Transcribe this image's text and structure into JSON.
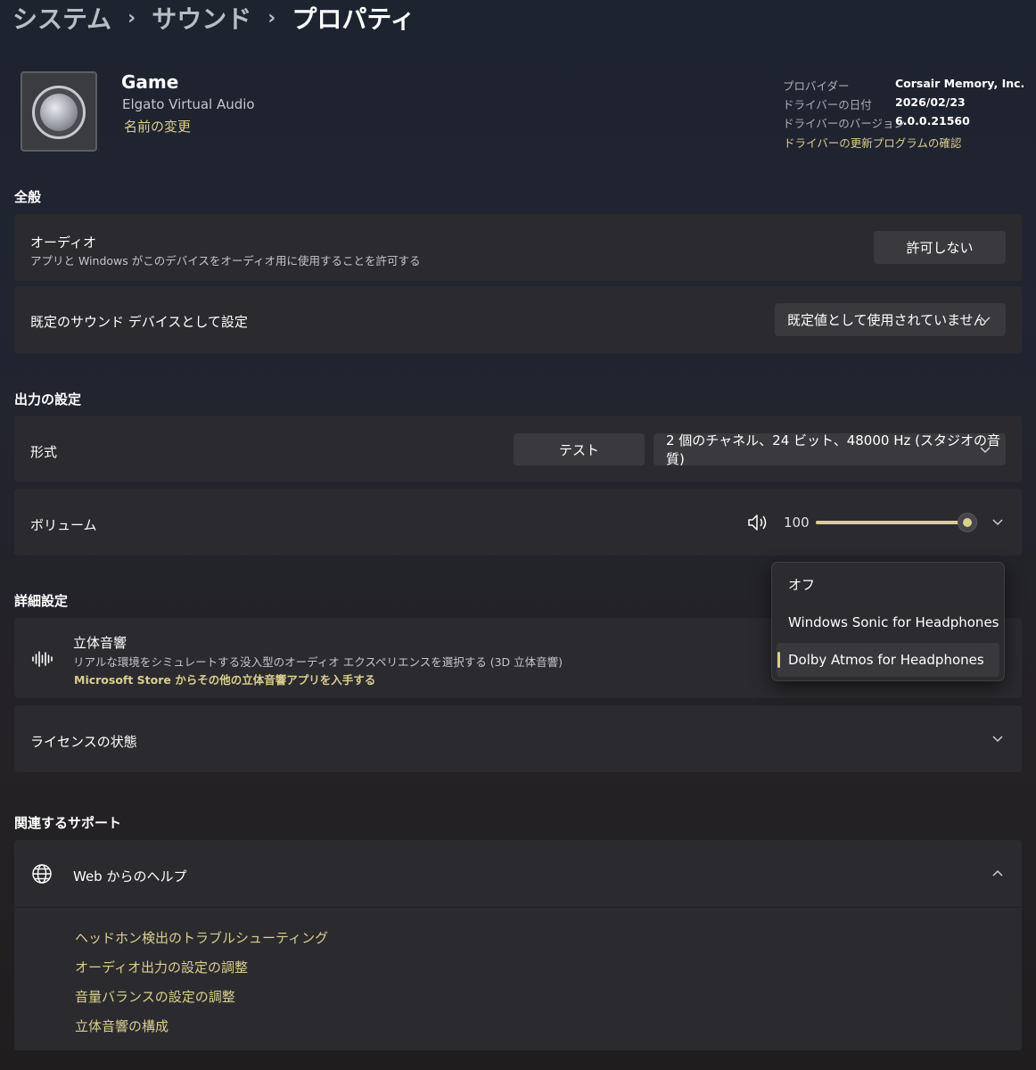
{
  "breadcrumb": [
    "システム",
    "サウンド",
    "プロパティ"
  ],
  "device": {
    "name": "Game",
    "subtitle": "Elgato Virtual Audio",
    "rename_label": "名前の変更",
    "icon": "speaker-icon"
  },
  "driver_info": {
    "provider_label": "プロバイダー",
    "provider_value": "Corsair Memory, Inc.",
    "date_label": "ドライバーの日付",
    "date_value": "2026/02/23",
    "version_label": "ドライバーのバージョン",
    "version_value": "6.0.0.21560",
    "update_link": "ドライバーの更新プログラムの確認"
  },
  "general": {
    "heading": "全般",
    "audio_title": "オーディオ",
    "audio_desc": "アプリと Windows がこのデバイスをオーディオ用に使用することを許可する",
    "audio_button": "許可しない",
    "default_title": "既定のサウンド デバイスとして設定",
    "default_value": "既定値として使用されていません"
  },
  "output": {
    "heading": "出力の設定",
    "format_title": "形式",
    "test_button": "テスト",
    "format_value": "2 個のチャネル、24 ビット、48000 Hz (スタジオの音質)",
    "volume_title": "ボリューム",
    "volume_value": "100",
    "volume_level": 1.0,
    "volume_icon": "speaker-volume-icon"
  },
  "advanced": {
    "heading": "詳細設定",
    "spatial_title": "立体音響",
    "spatial_desc": "リアルな環境をシミュレートする没入型のオーディオ エクスペリエンスを選択する (3D 立体音響)",
    "spatial_store_link": "Microsoft Store からその他の立体音響アプリを入手する",
    "spatial_icon": "waveform-icon",
    "license_title": "ライセンスの状態"
  },
  "spatial_menu": {
    "options": [
      "オフ",
      "Windows Sonic for Headphones",
      "Dolby Atmos for Headphones"
    ],
    "selected_index": 2
  },
  "support": {
    "heading": "関連するサポート",
    "web_help_title": "Web からのヘルプ",
    "web_help_icon": "globe-icon",
    "links": [
      "ヘッドホン検出のトラブルシューティング",
      "オーディオ出力の設定の調整",
      "音量バランスの設定の調整",
      "立体音響の構成"
    ]
  },
  "colors": {
    "accent": "#d9cf8f",
    "card": "#2b2b2f",
    "control": "#3a3a3e"
  }
}
